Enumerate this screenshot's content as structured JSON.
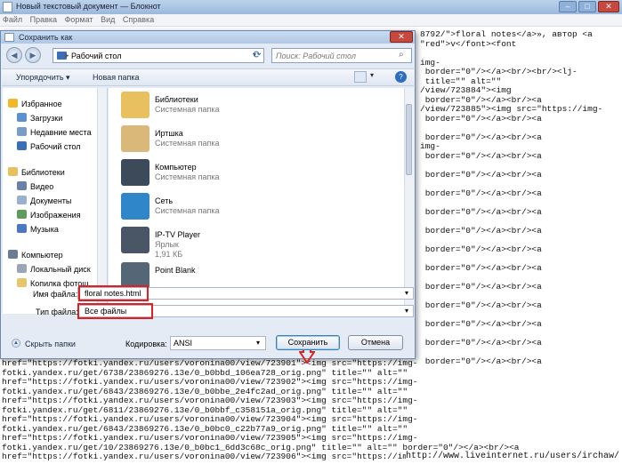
{
  "notepad": {
    "title": "Новый текстовый документ — Блокнот",
    "menu": [
      "Файл",
      "Правка",
      "Формат",
      "Вид",
      "Справка"
    ],
    "right_lines": [
      "8792/\">floral notes</a>», автор <a",
      "\"red\">v</font><font",
      "",
      "img-",
      " border=\"0\"/></a><br/><br/><lj-",
      " title=\"\" alt=\"\"",
      "/view/723884\"><img",
      " border=\"0\"/></a><br/><a",
      "/view/723885\"><img src=\"https://img-",
      " border=\"0\"/></a><br/><a",
      "",
      " border=\"0\"/></a><br/><a",
      "img-",
      " border=\"0\"/></a><br/><a",
      "",
      " border=\"0\"/></a><br/><a",
      "",
      " border=\"0\"/></a><br/><a",
      "",
      " border=\"0\"/></a><br/><a",
      "",
      " border=\"0\"/></a><br/><a",
      "",
      " border=\"0\"/></a><br/><a",
      "",
      " border=\"0\"/></a><br/><a",
      "",
      " border=\"0\"/></a><br/><a",
      "",
      " border=\"0\"/></a><br/><a",
      "",
      " border=\"0\"/></a><br/><a",
      "",
      " border=\"0\"/></a><br/><a",
      "",
      " border=\"0\"/></a><br/><a"
    ],
    "bottom_lines": [
      "href=\"https://fotki.yandex.ru/users/voronina00/view/723901\"><img src=\"https://img-",
      "fotki.yandex.ru/get/6738/23869276.13e/0_b0bbd_106ea728_orig.png\" title=\"\" alt=\"\"",
      "href=\"https://fotki.yandex.ru/users/voronina00/view/723902\"><img src=\"https://img-",
      "fotki.yandex.ru/get/6843/23869276.13e/0_b0bbe_2e4fc2ad_orig.png\" title=\"\" alt=\"\"",
      "href=\"https://fotki.yandex.ru/users/voronina00/view/723903\"><img src=\"https://img-",
      "fotki.yandex.ru/get/6811/23869276.13e/0_b0bbf_c358151a_orig.png\" title=\"\" alt=\"\"",
      "href=\"https://fotki.yandex.ru/users/voronina00/view/723904\"><img src=\"https://img-",
      "fotki.yandex.ru/get/6843/23869276.13e/0_b0bc0_c22b77a9_orig.png\" title=\"\" alt=\"\"",
      "href=\"https://fotki.yandex.ru/users/voronina00/view/723905\"><img src=\"https://img-",
      "fotki.yandex.ru/get/10/23869276.13e/0_b0bc1_6dd3c68c_orig.png\" title=\"\" alt=\"\" border=\"0\"/></a><br/><a",
      "href=\"https://fotki.yandex.ru/users/voronina00/view/723906\"><img src=\"https://img-"
    ],
    "watermark": "http://www.liveinternet.ru/users/irchaw/"
  },
  "dialog": {
    "title": "Сохранить как",
    "address": "Рабочий стол",
    "search_placeholder": "Поиск: Рабочий стол",
    "toolbar": {
      "organize": "Упорядочить ▾",
      "new_folder": "Новая папка"
    },
    "nav": [
      {
        "label": "Избранное",
        "icon": "star-icon",
        "color": "#f0b82a"
      },
      {
        "label": "Загрузки",
        "icon": "downloads-folder-icon",
        "color": "#5a8fd0"
      },
      {
        "label": "Недавние места",
        "icon": "recent-places-icon",
        "color": "#7a9cc8"
      },
      {
        "label": "Рабочий стол",
        "icon": "desktop-icon",
        "color": "#3a6fb8"
      },
      {
        "label": "Библиотеки",
        "icon": "libraries-icon",
        "color": "#e8c060"
      },
      {
        "label": "Видео",
        "icon": "video-icon",
        "color": "#6a80a8"
      },
      {
        "label": "Документы",
        "icon": "documents-icon",
        "color": "#9ab0cc"
      },
      {
        "label": "Изображения",
        "icon": "pictures-icon",
        "color": "#5e9c5a"
      },
      {
        "label": "Музыка",
        "icon": "music-icon",
        "color": "#4b78c2"
      },
      {
        "label": "Компьютер",
        "icon": "computer-icon",
        "color": "#6a7c94"
      },
      {
        "label": "Локальный диск",
        "icon": "disk-icon",
        "color": "#9aa6b8"
      },
      {
        "label": "Копилка фотош",
        "icon": "folder-icon",
        "color": "#e7c66a"
      }
    ],
    "files": [
      {
        "name": "Библиотеки",
        "type": "Системная папка",
        "icon": "libraries-icon",
        "color": "#e8c060"
      },
      {
        "name": "Иртшка",
        "type": "Системная папка",
        "icon": "user-folder-icon",
        "color": "#d9b87a"
      },
      {
        "name": "Компьютер",
        "type": "Системная папка",
        "icon": "computer-icon",
        "color": "#3d4a5a"
      },
      {
        "name": "Сеть",
        "type": "Системная папка",
        "icon": "network-icon",
        "color": "#2f86c8"
      },
      {
        "name": "IP-TV Player",
        "type": "Ярлык",
        "size": "1,91 КБ",
        "icon": "tv-icon",
        "color": "#4a5566"
      },
      {
        "name": "Point Blank",
        "type": "",
        "icon": "game-icon",
        "color": "#556677"
      }
    ],
    "filename_label": "Имя файла:",
    "filename_value": "floral notes.html",
    "filetype_label": "Тип файла:",
    "filetype_value": "Все файлы",
    "hide_folders": "Скрыть папки",
    "encoding_label": "Кодировка:",
    "encoding_value": "ANSI",
    "save": "Сохранить",
    "cancel": "Отмена",
    "highlight_color": "#e02020"
  }
}
